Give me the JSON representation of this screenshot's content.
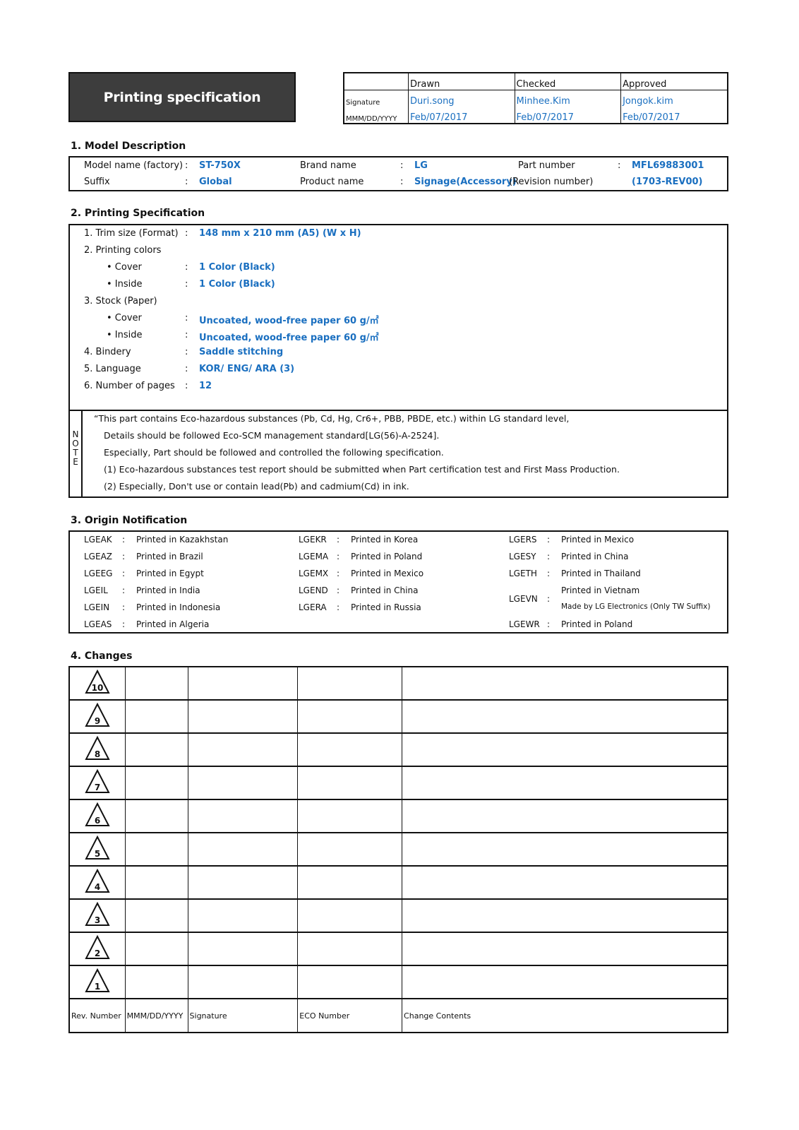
{
  "header": {
    "title": "Printing specification",
    "signature_table": {
      "columns": [
        "Drawn",
        "Checked",
        "Approved"
      ],
      "rows": [
        {
          "label": "Signature",
          "values": [
            "Duri.song",
            "Minhee.Kim",
            "Jongok.kim"
          ]
        },
        {
          "label": "MMM/DD/YYYY",
          "values": [
            "Feb/07/2017",
            "Feb/07/2017",
            "Feb/07/2017"
          ]
        }
      ]
    }
  },
  "model_description": {
    "title": "1. Model Description",
    "rows": [
      [
        {
          "label": "Model name (factory)",
          "value": "ST-750X"
        },
        {
          "label": "Brand name",
          "value": "LG"
        },
        {
          "label": "Part number",
          "value": "MFL69883001"
        }
      ],
      [
        {
          "label": "Suffix",
          "value": "Global"
        },
        {
          "label": "Product name",
          "value": "Signage(Accessory)"
        },
        {
          "label": "(Revision number)",
          "value": "(1703-REV00)"
        }
      ]
    ],
    "colon": ":"
  },
  "printing_spec": {
    "title": "2. Printing Specification",
    "items": [
      {
        "label": "1. Trim size (Format)",
        "value": "148 mm x 210 mm (A5) (W x H)"
      },
      {
        "label": "2. Printing colors",
        "value": ""
      },
      {
        "label": "• Cover",
        "value": "1 Color (Black)",
        "indent": true
      },
      {
        "label": "• Inside",
        "value": "1 Color (Black)",
        "indent": true
      },
      {
        "label": "3. Stock (Paper)",
        "value": ""
      },
      {
        "label": "• Cover",
        "value": "Uncoated, wood-free paper 60 g/㎡",
        "indent": true
      },
      {
        "label": "• Inside",
        "value": "Uncoated, wood-free paper 60 g/㎡",
        "indent": true
      },
      {
        "label": "4. Bindery",
        "value": "Saddle stitching"
      },
      {
        "label": "5. Language",
        "value": "KOR/ ENG/ ARA (3)"
      },
      {
        "label": "6. Number of pages",
        "value": "12"
      }
    ],
    "note": {
      "label": [
        "N",
        "O",
        "T",
        "E"
      ],
      "lines": [
        "“This part contains Eco-hazardous substances (Pb, Cd, Hg, Cr6+, PBB, PBDE, etc.) within LG standard level,",
        "Details should be followed Eco-SCM management standard[LG(56)-A-2524].",
        "Especially, Part should be followed and controlled the following specification.",
        "(1) Eco-hazardous substances test report should be submitted when Part certification test and First Mass Production.",
        "(2) Especially, Don't use or contain lead(Pb) and cadmium(Cd) in ink."
      ]
    }
  },
  "origin": {
    "title": "3. Origin Notification",
    "columns": [
      [
        {
          "code": "LGEAK",
          "text": "Printed in Kazakhstan"
        },
        {
          "code": "LGEAZ",
          "text": "Printed in Brazil"
        },
        {
          "code": "LGEEG",
          "text": "Printed in Egypt"
        },
        {
          "code": "LGEIL",
          "text": "Printed in India"
        },
        {
          "code": "LGEIN",
          "text": "Printed in Indonesia"
        },
        {
          "code": "LGEAS",
          "text": "Printed in Algeria"
        }
      ],
      [
        {
          "code": "LGEKR",
          "text": "Printed in Korea"
        },
        {
          "code": "LGEMA",
          "text": "Printed in Poland"
        },
        {
          "code": "LGEMX",
          "text": "Printed in Mexico"
        },
        {
          "code": "LGEND",
          "text": "Printed in China"
        },
        {
          "code": "LGERA",
          "text": "Printed in Russia"
        }
      ],
      [
        {
          "code": "LGERS",
          "text": "Printed in Mexico"
        },
        {
          "code": "LGESY",
          "text": "Printed in China"
        },
        {
          "code": "LGETH",
          "text": "Printed in Thailand"
        },
        {
          "code": "LGEVN",
          "text": "Printed in Vietnam",
          "text2": "Made by LG Electronics (Only TW Suffix)"
        },
        {
          "code": "LGEWR",
          "text": "Printed in Poland"
        }
      ]
    ]
  },
  "changes": {
    "title": "4. Changes",
    "revisions": [
      "10",
      "9",
      "8",
      "7",
      "6",
      "5",
      "4",
      "3",
      "2",
      "1"
    ],
    "footer": [
      "Rev. Number",
      "MMM/DD/YYYY",
      "Signature",
      "ECO Number",
      "Change Contents"
    ]
  }
}
